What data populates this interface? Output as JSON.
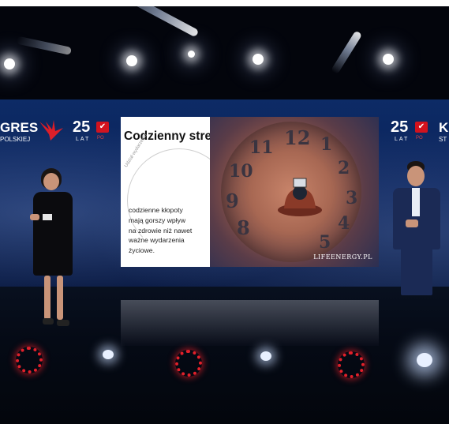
{
  "screen": {
    "left_brand": {
      "title_fragment": "GRES",
      "subtitle_fragment": "POLSKIEJ",
      "anniversary_number": "25",
      "anniversary_word": "LAT",
      "badge_text": "PO"
    },
    "right_brand": {
      "anniversary_number": "25",
      "anniversary_word": "LAT",
      "badge_text": "PO",
      "title_fragment": "K",
      "subtitle_fragment": "ST"
    }
  },
  "slide": {
    "title": "Codzienny stres",
    "arc_label": "Udział wydarzeniu",
    "body_lines": [
      "codzienne kłopoty",
      "mają gorszy wpływ",
      "na zdrowie niż nawet",
      "ważne wydarzenia",
      "życiowe."
    ],
    "watermark": "LIFEENERGY.PL",
    "clock_numbers": [
      "12",
      "1",
      "2",
      "3",
      "4",
      "5",
      "8",
      "9",
      "10",
      "11"
    ]
  },
  "colors": {
    "led_wall": "#0d2b66",
    "brand_red": "#d3121d",
    "floor": "#050a15"
  }
}
